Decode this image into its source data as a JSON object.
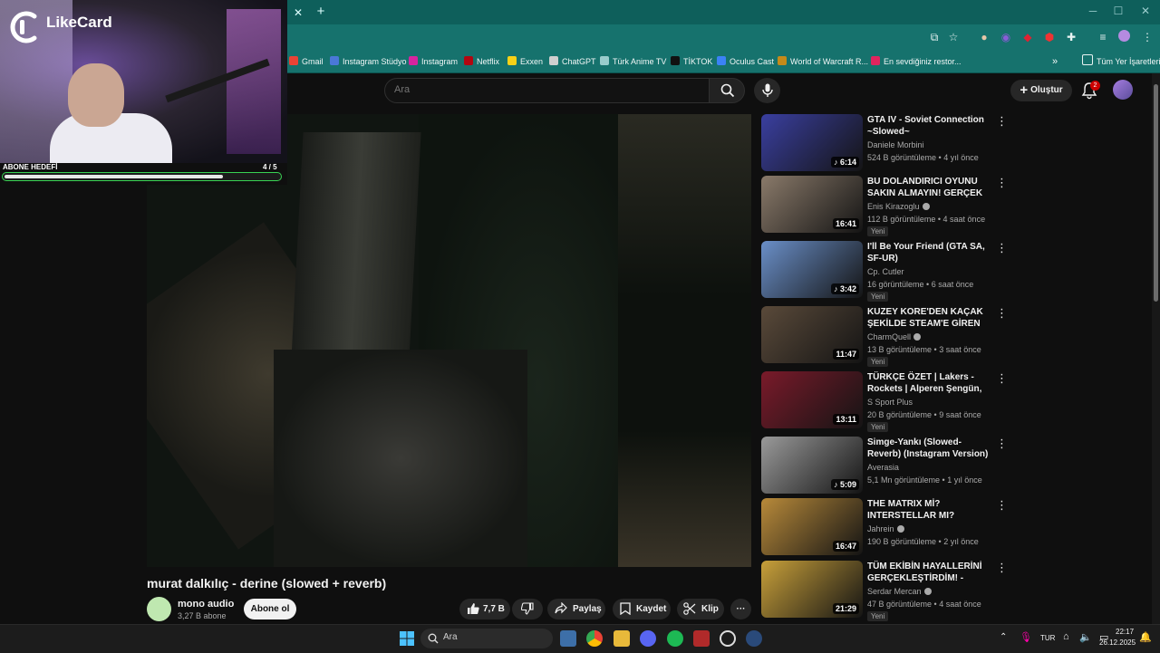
{
  "browser": {
    "tab_close": "✕",
    "tab_new": "+",
    "bookmarks": [
      {
        "label": "Gmail",
        "color": "#ea4335"
      },
      {
        "label": "Instagram Stüdyo",
        "color": "#4a78d8"
      },
      {
        "label": "Instagram",
        "color": "#d6249f"
      },
      {
        "label": "Netflix",
        "color": "#b20710"
      },
      {
        "label": "Exxen",
        "color": "#f7d117"
      },
      {
        "label": "ChatGPT",
        "color": "#cfcfcf"
      },
      {
        "label": "Türk Anime TV",
        "color": "#9cc"
      },
      {
        "label": "TİKTOK",
        "color": "#111111"
      },
      {
        "label": "Oculus Cast",
        "color": "#3b82f6"
      },
      {
        "label": "World of Warcraft R...",
        "color": "#c48a1a"
      },
      {
        "label": "En sevdiğiniz restor...",
        "color": "#e0245e"
      }
    ],
    "bookmarks_more": "»",
    "all_bookmarks": "Tüm Yer İşaretleri"
  },
  "header": {
    "search_placeholder": "Ara",
    "create_label": "Oluştur",
    "notification_count": "2"
  },
  "video": {
    "title": "murat dalkılıç - derine (slowed + reverb)",
    "channel": "mono audio",
    "subscribers": "3,27 B abone",
    "subscribe_label": "Abone ol",
    "likes": "7,7 B",
    "share_label": "Paylaş",
    "save_label": "Kaydet",
    "clip_label": "Klip",
    "more_label": "···"
  },
  "recommendations": [
    {
      "title": "GTA IV - Soviet Connection ~Slowed~",
      "channel": "Daniele Morbini",
      "verified": false,
      "meta": "524 B görüntüleme • 4 yıl önce",
      "duration": "6:14",
      "music": true,
      "badge": "",
      "thumb": "#3a3fa0"
    },
    {
      "title": "BU DOLANDIRICI OYUNU SAKIN ALMAYIN! GERÇEK GİBİ ...",
      "channel": "Enis Kirazoglu",
      "verified": true,
      "meta": "112 B görüntüleme • 4 saat önce",
      "duration": "16:41",
      "music": false,
      "badge": "Yeni",
      "thumb": "#8a7a6a"
    },
    {
      "title": "I'll Be Your Friend (GTA SA, SF-UR)",
      "channel": "Cp. Cutler",
      "verified": false,
      "meta": "16 görüntüleme • 6 saat önce",
      "duration": "3:42",
      "music": true,
      "badge": "Yeni",
      "thumb": "#6a8fc8"
    },
    {
      "title": "KUZEY KORE'DEN KAÇAK ŞEKİLDE STEAM'E GİREN ADA...",
      "channel": "CharmQuell",
      "verified": true,
      "meta": "13 B görüntüleme • 3 saat önce",
      "duration": "11:47",
      "music": false,
      "badge": "Yeni",
      "thumb": "#5a4a3a"
    },
    {
      "title": "TÜRKÇE ÖZET | Lakers - Rockets | Alperen Şengün, ...",
      "channel": "S Sport Plus",
      "verified": false,
      "meta": "20 B görüntüleme • 9 saat önce",
      "duration": "13:11",
      "music": false,
      "badge": "Yeni",
      "thumb": "#7a1a2a"
    },
    {
      "title": "Simge-Yankı (Slowed-Reverb) (Instagram Version)",
      "channel": "Averasia",
      "verified": false,
      "meta": "5,1 Mn görüntüleme • 1 yıl önce",
      "duration": "5:09",
      "music": true,
      "badge": "",
      "thumb": "#9a9a9a"
    },
    {
      "title": "THE MATRIX Mİ? INTERSTELLAR MI?",
      "channel": "Jahrein",
      "verified": true,
      "meta": "190 B görüntüleme • 2 yıl önce",
      "duration": "16:47",
      "music": false,
      "badge": "",
      "thumb": "#b88a3a"
    },
    {
      "title": "TÜM EKİBİN HAYALLERİNİ GERÇEKLEŞTİRDİM! - TEMU ...",
      "channel": "Serdar Mercan",
      "verified": true,
      "meta": "47 B görüntüleme • 4 saat önce",
      "duration": "21:29",
      "music": false,
      "badge": "Yeni",
      "thumb": "#c8a03a"
    }
  ],
  "overlay": {
    "logo_text": "LikeCard",
    "goal_label": "ABONE HEDEFİ",
    "goal_count": "4 / 5",
    "goal_fraction": 0.8
  },
  "taskbar": {
    "search_label": "Ara",
    "lang": "TUR",
    "time": "22:17",
    "date": "26.12.2025"
  }
}
